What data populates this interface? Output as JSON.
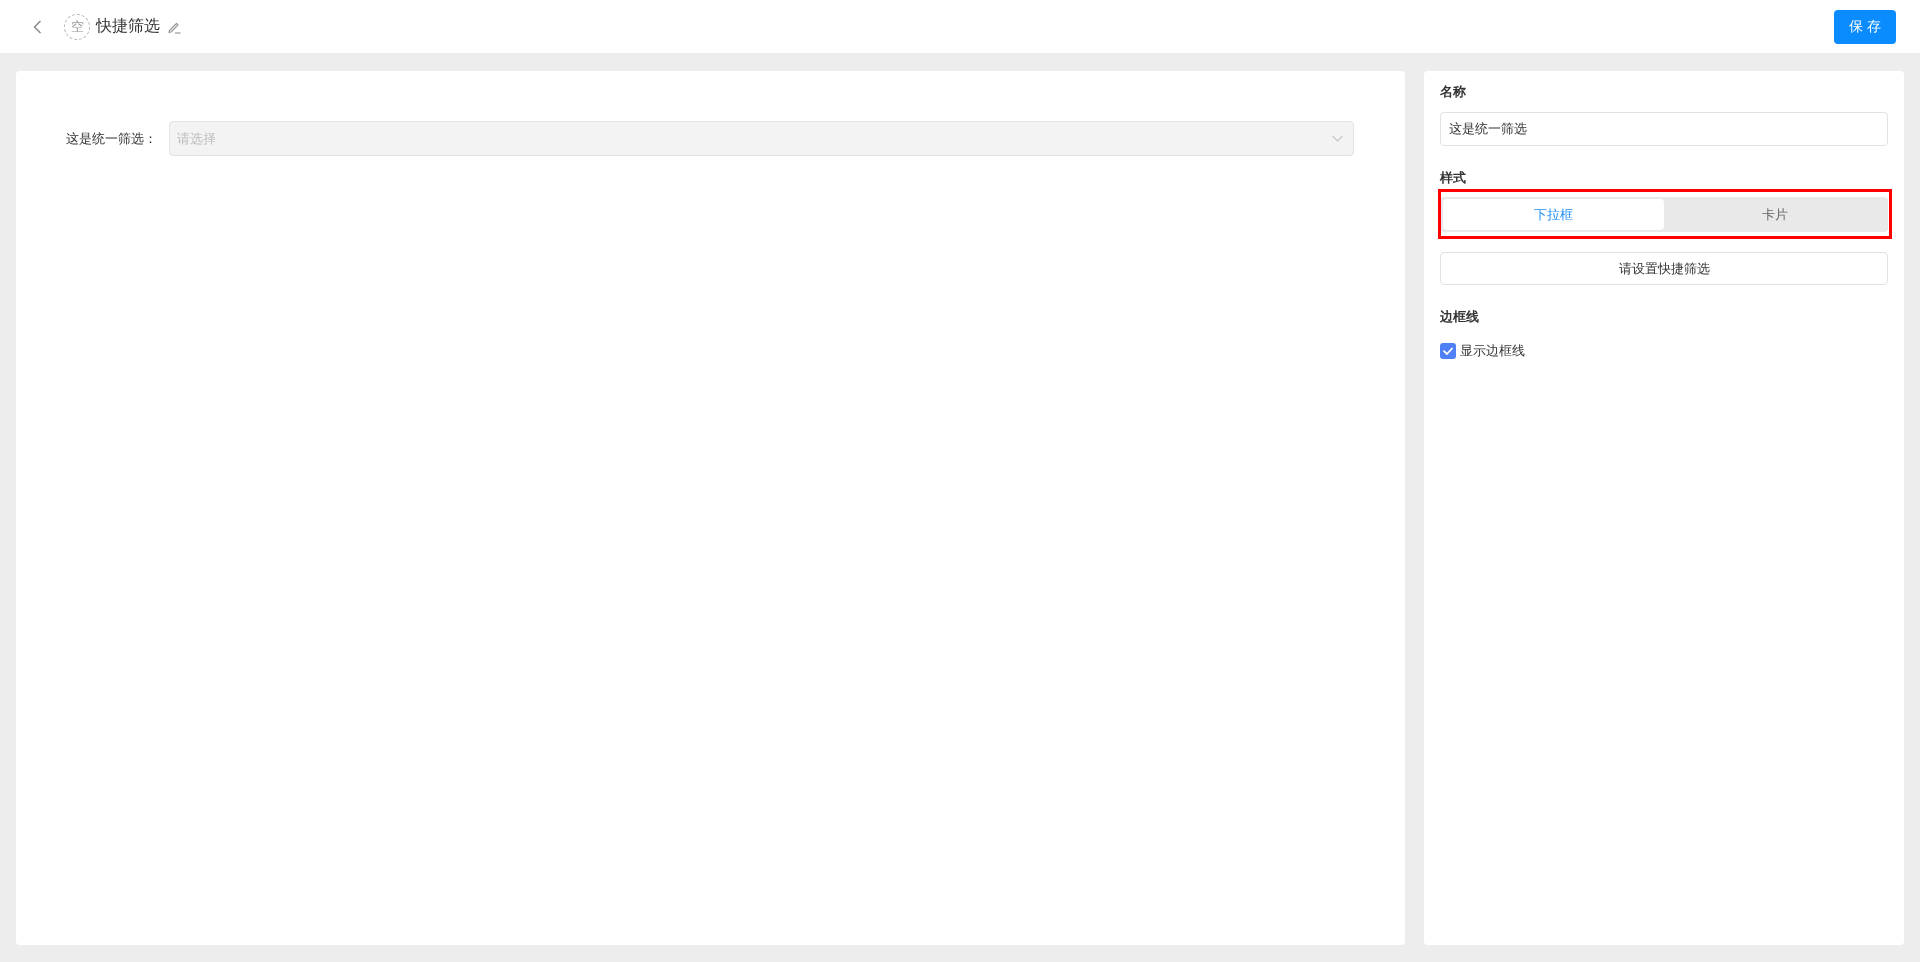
{
  "header": {
    "avatar_text": "空",
    "title": "快捷筛选",
    "save_button": "保 存"
  },
  "canvas": {
    "filters": [
      {
        "label": "这是统一筛选：",
        "placeholder": "请选择",
        "disabled": true
      }
    ]
  },
  "settings": {
    "name": {
      "label": "名称",
      "value": "这是统一筛选"
    },
    "style": {
      "label": "样式",
      "highlighted": true,
      "options": [
        {
          "label": "下拉框",
          "selected": true
        },
        {
          "label": "卡片",
          "selected": false
        }
      ]
    },
    "setup_button": "请设置快捷筛选",
    "border": {
      "label": "边框线",
      "checkbox": {
        "label": "显示边框线",
        "checked": true
      }
    }
  }
}
